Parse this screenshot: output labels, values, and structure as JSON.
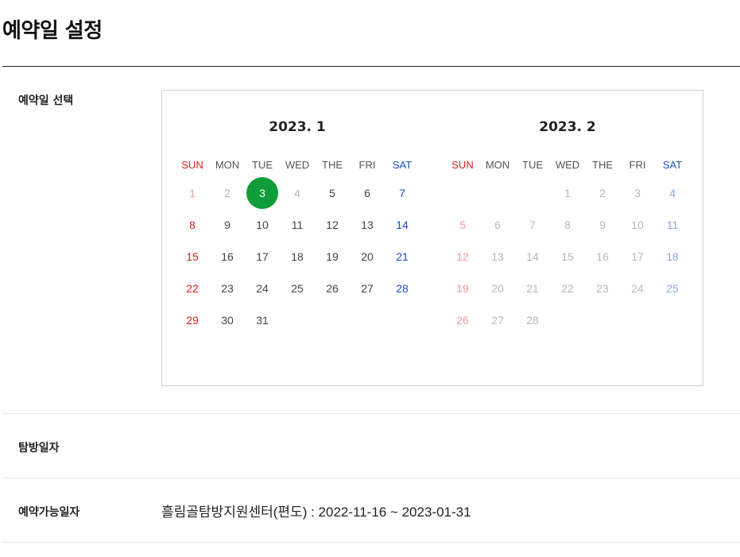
{
  "page": {
    "title": "예약일 설정"
  },
  "rows": {
    "date_select_label": "예약일 선택",
    "visit_date_label": "탐방일자",
    "available_label": "예약가능일자",
    "available_value": "흘림골탐방지원센터(편도) : 2022-11-16 ~ 2023-01-31"
  },
  "calendar": {
    "weekdays": [
      "SUN",
      "MON",
      "TUE",
      "WED",
      "THE",
      "FRI",
      "SAT"
    ],
    "selected_color": "#0f9d3a",
    "sunday_color": "#e02020",
    "saturday_color": "#1a4fc4",
    "months": [
      {
        "title": "2023. 1",
        "first_weekday": 0,
        "days": 31,
        "selected_day": 3,
        "disabled_days": [
          1,
          2,
          4
        ],
        "disabled_from": 32
      },
      {
        "title": "2023. 2",
        "first_weekday": 3,
        "days": 28,
        "selected_day": null,
        "disabled_days": [],
        "disabled_from": 1
      }
    ]
  }
}
